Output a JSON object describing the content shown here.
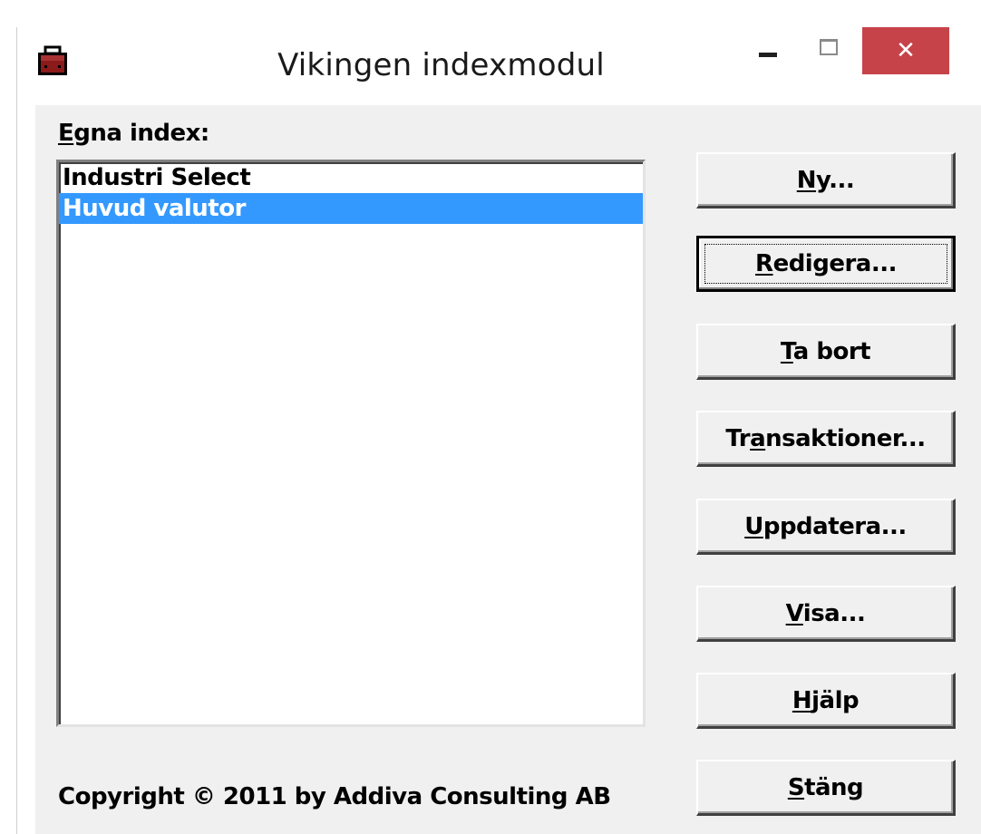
{
  "window": {
    "title": "Vikingen indexmodul",
    "app_icon": "briefcase-icon",
    "close_glyph": "✕"
  },
  "list": {
    "label_mnemonic": "E",
    "label_rest": "gna index:",
    "items": [
      {
        "label": "Industri Select",
        "selected": false
      },
      {
        "label": "Huvud valutor",
        "selected": true
      }
    ]
  },
  "buttons": {
    "ny": {
      "pre": "",
      "key": "N",
      "post": "y..."
    },
    "redigera": {
      "pre": "",
      "key": "R",
      "post": "edigera..."
    },
    "ta_bort": {
      "pre": "",
      "key": "T",
      "post": "a bort"
    },
    "transaktioner": {
      "pre": "Tr",
      "key": "a",
      "post": "nsaktioner..."
    },
    "uppdatera": {
      "pre": "",
      "key": "U",
      "post": "ppdatera..."
    },
    "visa": {
      "pre": "",
      "key": "V",
      "post": "isa..."
    },
    "hjalp": {
      "pre": "",
      "key": "H",
      "post": "jälp"
    },
    "stang": {
      "pre": "",
      "key": "S",
      "post": "täng"
    }
  },
  "footer": {
    "copyright": "Copyright © 2011 by Addiva Consulting AB"
  },
  "colors": {
    "close_button": "#c7434a",
    "selection": "#3399ff",
    "face": "#f0f0f0"
  }
}
